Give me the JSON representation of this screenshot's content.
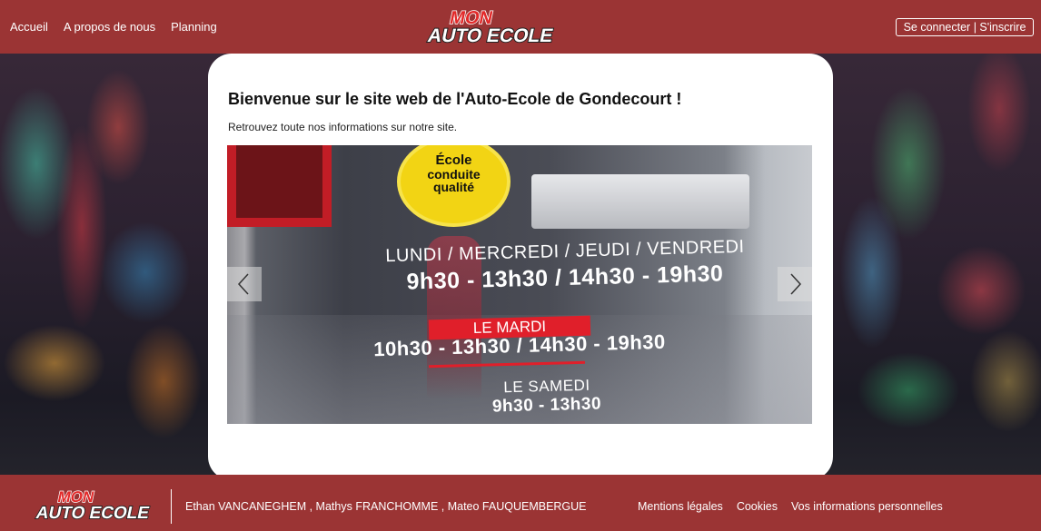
{
  "header": {
    "nav": [
      "Accueil",
      "A propos de nous",
      "Planning"
    ],
    "logo": {
      "line1": "MON",
      "line2": "AUTO ECOLE"
    },
    "auth_label": "Se connecter | S'inscrire"
  },
  "main": {
    "title": "Bienvenue sur le site web de l'Auto-Ecole de Gondecourt !",
    "subtitle": "Retrouvez toute nos informations sur notre site."
  },
  "carousel": {
    "prev_icon": "chevron-left-icon",
    "next_icon": "chevron-right-icon",
    "slide": {
      "sticker_line1": "École",
      "sticker_line2": "conduite",
      "sticker_line3": "qualité",
      "days": "LUNDI / MERCREDI / JEUDI / VENDREDI",
      "hours1": "9h30 - 13h30 / 14h30 - 19h30",
      "tuesday_label": "LE MARDI",
      "hours2": "10h30 - 13h30 / 14h30 - 19h30",
      "saturday_label": "LE SAMEDI",
      "hours3": "9h30 - 13h30"
    }
  },
  "footer": {
    "logo": {
      "line1": "MON",
      "line2": "AUTO ECOLE"
    },
    "authors": "Ethan VANCANEGHEM , Mathys FRANCHOMME , Mateo FAUQUEMBERGUE",
    "links": [
      "Mentions légales",
      "Cookies",
      "Vos informations personnelles"
    ]
  },
  "colors": {
    "brand_red": "#9b3434",
    "card_bg": "#ffffff",
    "accent_red": "#e01f2a",
    "sticker_yellow": "#f2d414"
  }
}
